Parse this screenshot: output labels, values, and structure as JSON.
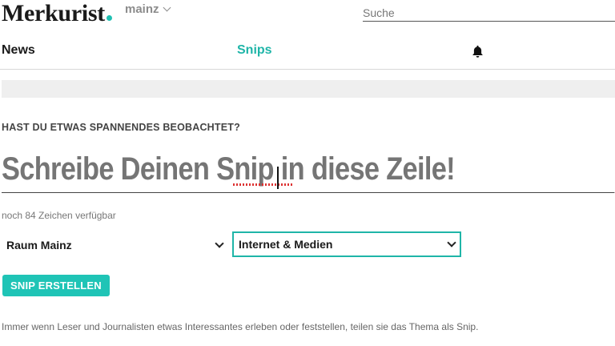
{
  "header": {
    "logo": "Merkurist",
    "city": "mainz",
    "search_placeholder": "Suche"
  },
  "nav": {
    "news": "News",
    "snips": "Snips",
    "bell_icon": "bell-icon"
  },
  "form": {
    "kicker": "HAST DU ETWAS SPANNENDES BEOBACHTET?",
    "headline_placeholder": "Schreibe Deinen Snip in diese Zeile!",
    "counter": "noch 84 Zeichen verfügbar",
    "region_select": "Raum Mainz",
    "topic_select": "Internet & Medien",
    "submit_label": "SNIP ERSTELLEN",
    "info": "Immer wenn Leser und Journalisten etwas Interessantes erleben oder feststellen, teilen sie das Thema als Snip."
  },
  "colors": {
    "accent": "#1fb5a8",
    "button": "#1fc4b6"
  }
}
